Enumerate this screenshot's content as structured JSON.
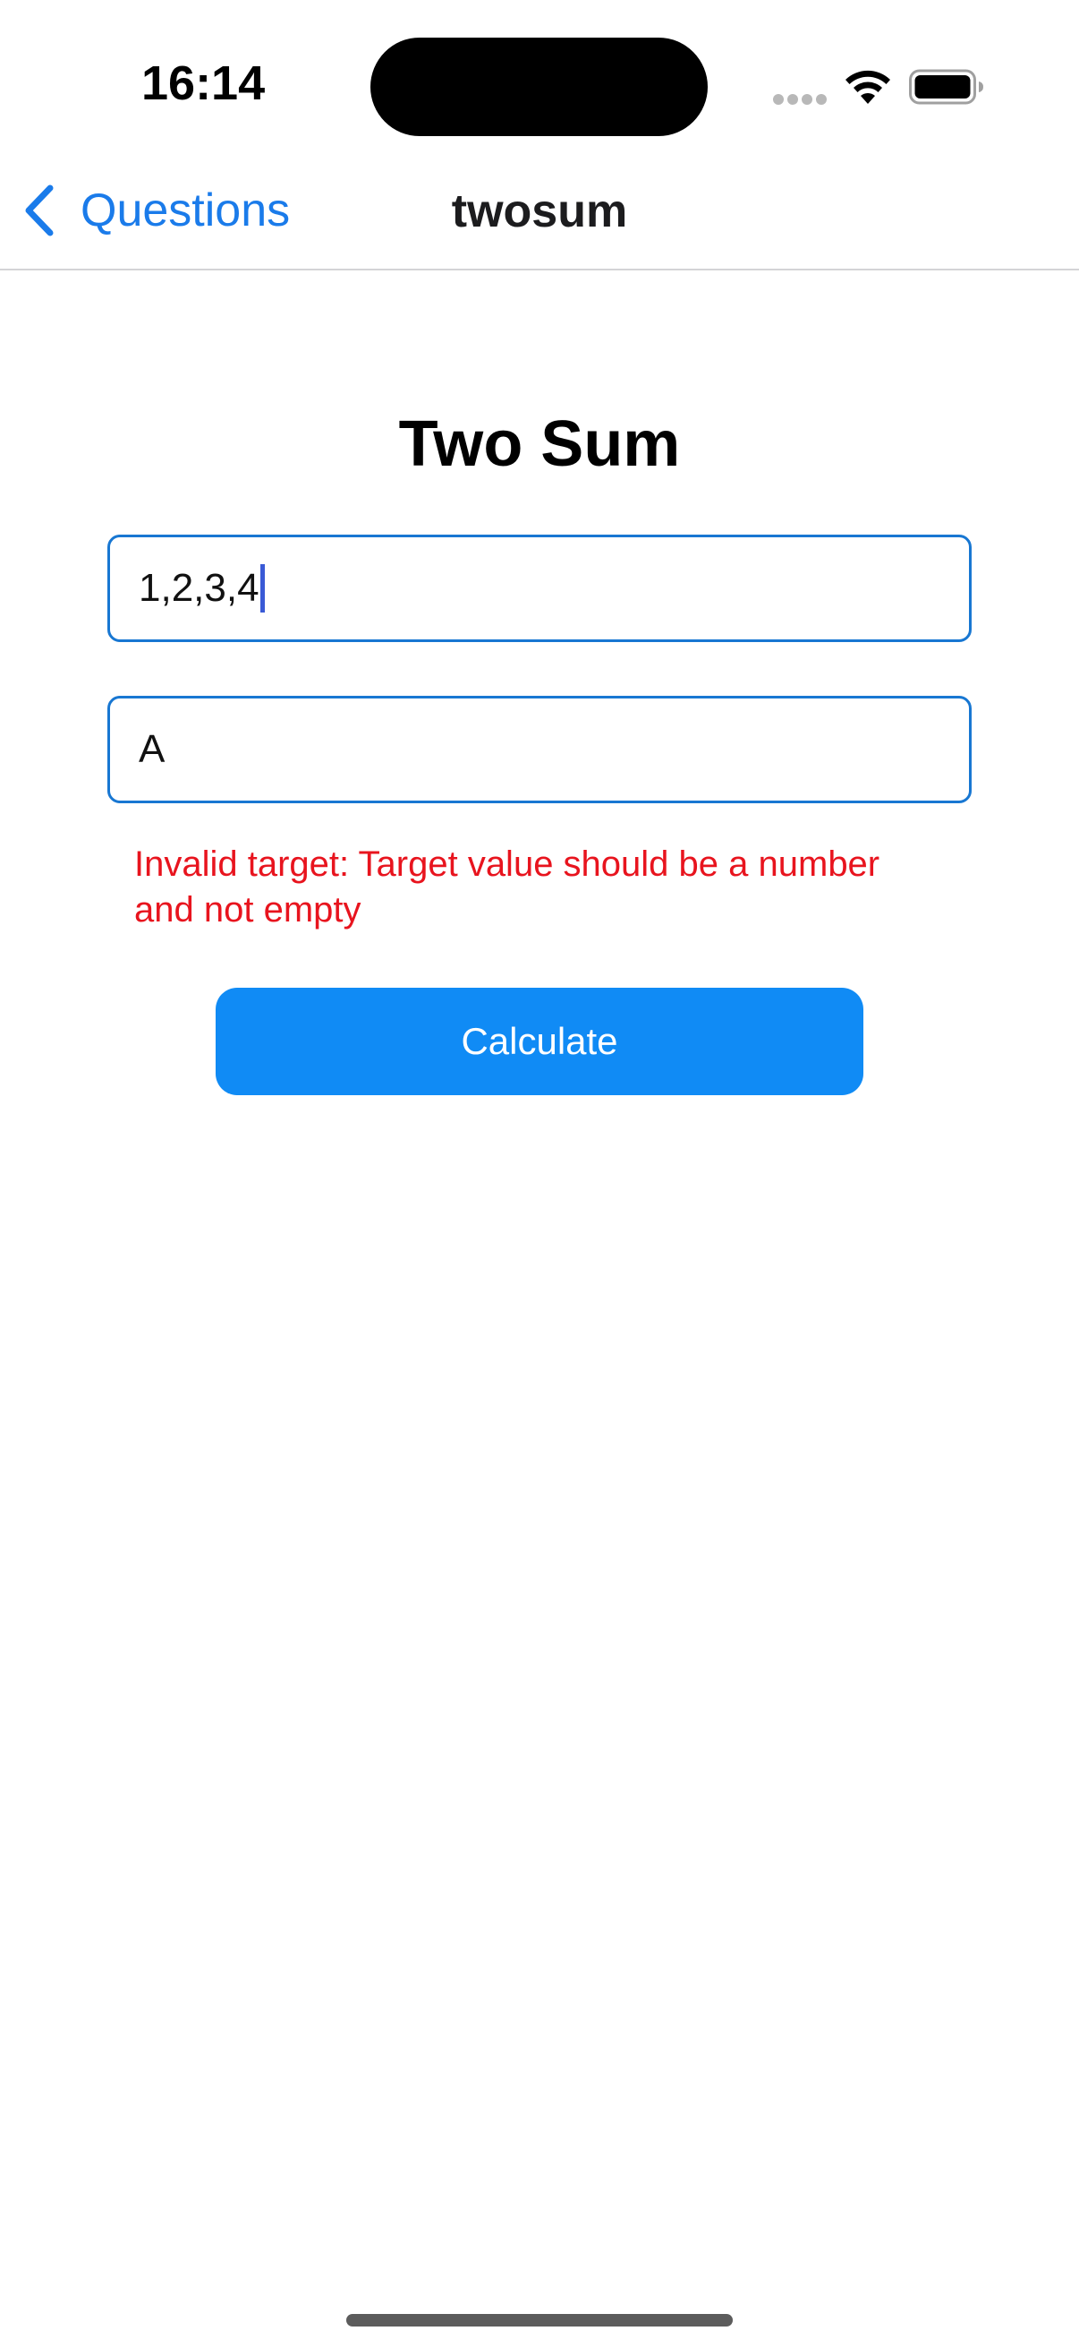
{
  "status_bar": {
    "time": "16:14",
    "icons": [
      "signal-icon",
      "wifi-icon",
      "battery-icon"
    ]
  },
  "nav": {
    "back_label": "Questions",
    "title": "twosum"
  },
  "main": {
    "heading": "Two Sum",
    "nums_field": {
      "value": "1,2,3,4"
    },
    "target_field": {
      "value": "A"
    },
    "error_message": "Invalid target: Target value should be a number and not empty",
    "calculate_label": "Calculate"
  },
  "colors": {
    "accent": "#1a7bea",
    "button": "#108bf5",
    "field_border": "#1877d2",
    "error": "#e8141e"
  }
}
